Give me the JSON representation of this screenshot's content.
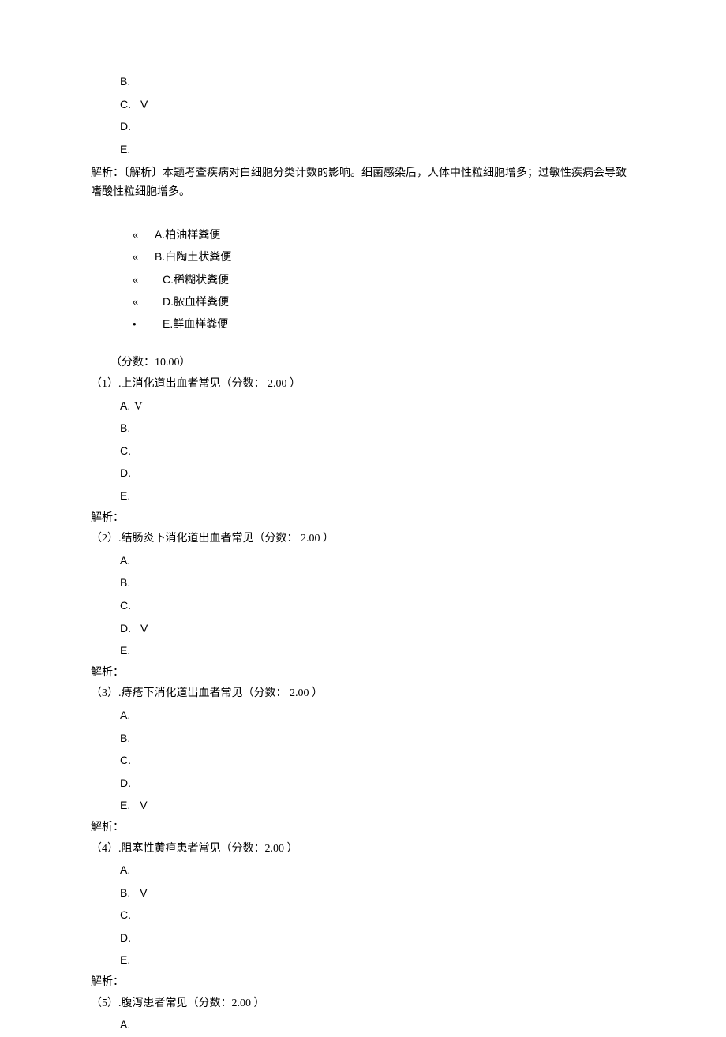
{
  "top_options": {
    "b": "B.",
    "c_letter": "C.",
    "c_mark": "V",
    "d": "D.",
    "e": "E."
  },
  "top_analysis": "解析：〔解析〕本题考查疾病对白细胞分类计数的影响。细菌感染后，人体中性粒细胞增多；过敏性疾病会导致嗜酸性粒细胞增多。",
  "choice_set": {
    "a": {
      "bullet": "«",
      "label": "A.",
      "text": "柏油样粪便"
    },
    "b": {
      "bullet": "«",
      "label": "B.",
      "text": "白陶土状粪便"
    },
    "c": {
      "bullet": "«",
      "label": "C.",
      "text": "稀糊状粪便"
    },
    "d": {
      "bullet": "«",
      "label": "D.",
      "text": "脓血样粪便"
    },
    "e": {
      "bullet": "•",
      "label": "E.",
      "text": "鲜血样粪便"
    }
  },
  "total_score": "（分数：10.00）",
  "letters": {
    "a": "A.",
    "b": "B.",
    "c": "C.",
    "d": "D.",
    "e": "E."
  },
  "mark": "V",
  "analysis_label": "解析：",
  "q1": {
    "stem": "（1）.上消化道出血者常见（分数： 2.00 ）"
  },
  "q2": {
    "stem": "（2）.结肠炎下消化道出血者常见（分数： 2.00 ）"
  },
  "q3": {
    "stem": "（3）.痔疮下消化道出血者常见（分数： 2.00 ）"
  },
  "q4": {
    "stem": "（4）.阻塞性黄疸患者常见（分数：2.00 ）"
  },
  "q5": {
    "stem": "（5）.腹泻患者常见（分数：2.00 ）"
  }
}
